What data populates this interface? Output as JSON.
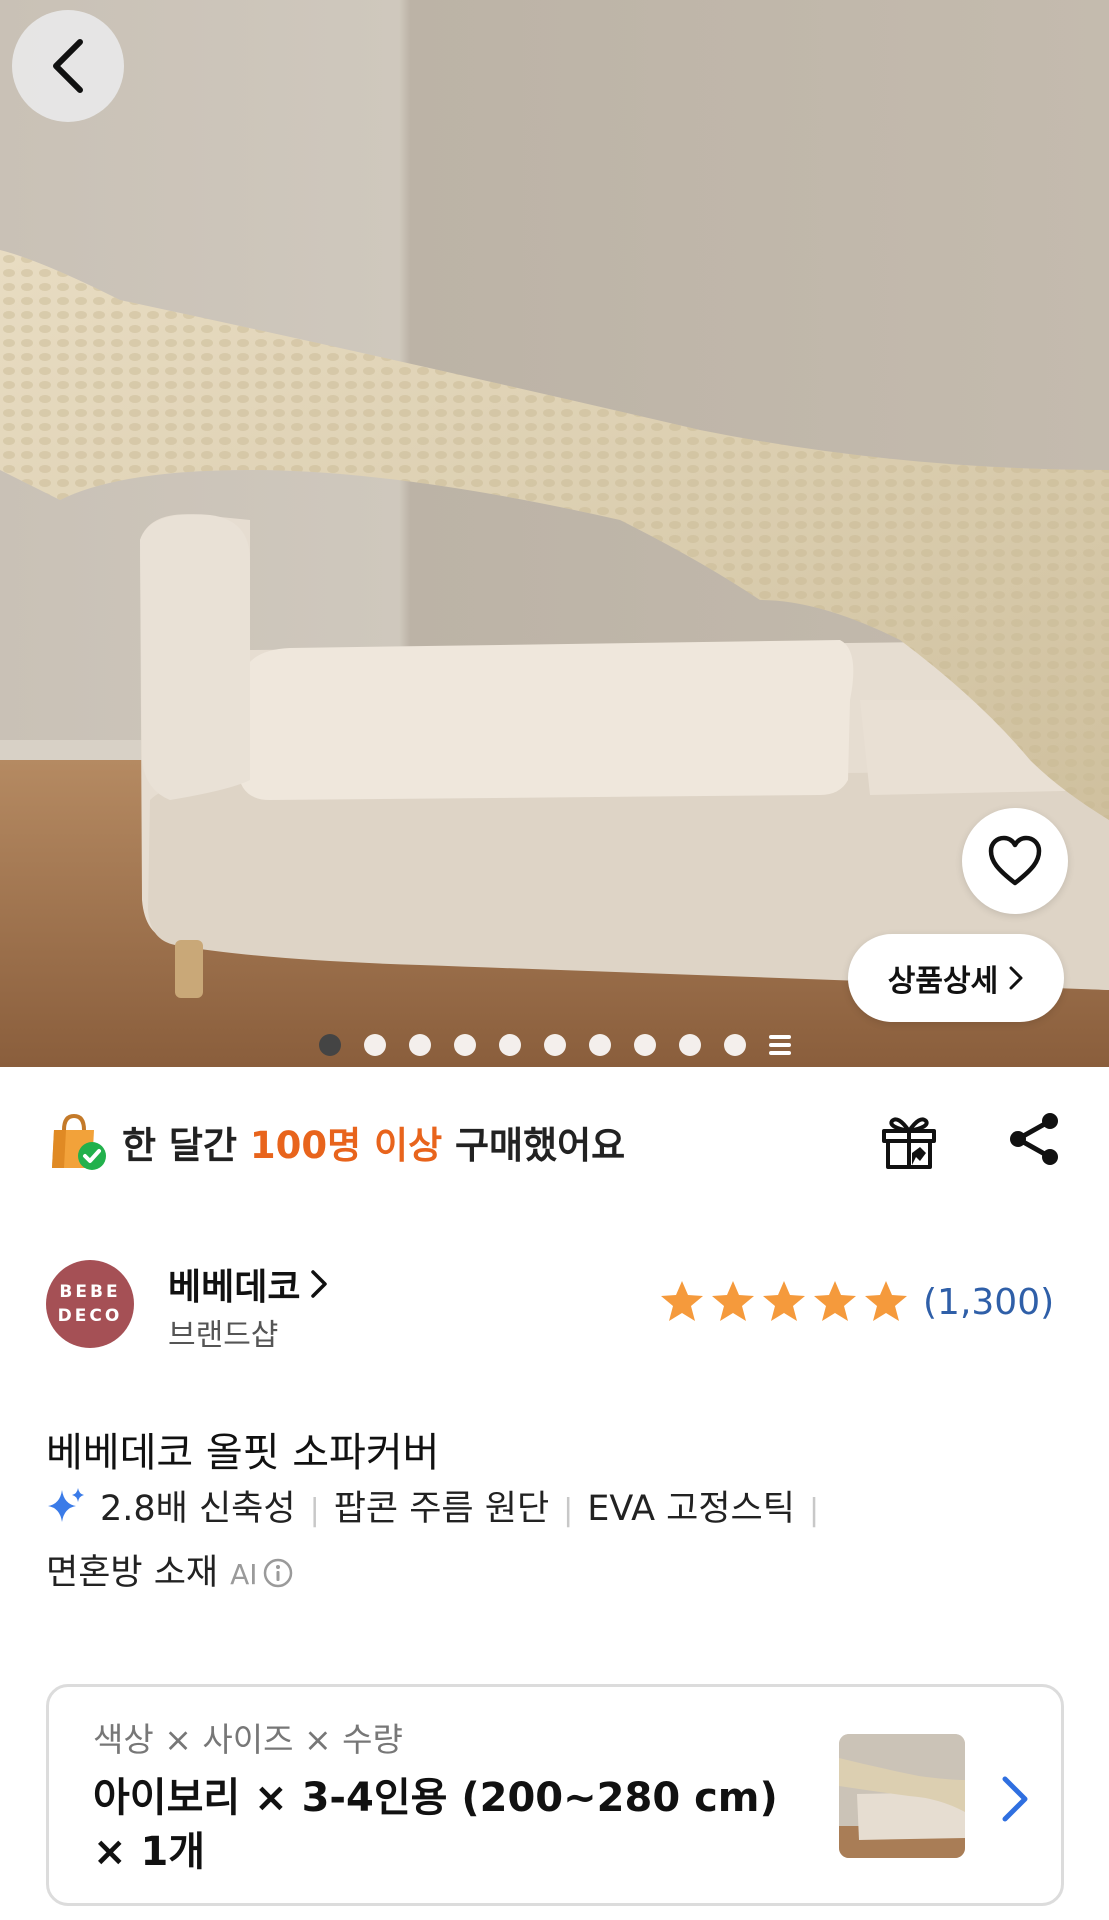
{
  "hero": {
    "image_description_icon": "sofa-cover-product-photo",
    "slide_count": 10,
    "active_slide": 1,
    "detail_button_label": "상품상세"
  },
  "purchase_info": {
    "prefix": "한 달간 ",
    "highlight": "100명 이상",
    "suffix": " 구매했어요",
    "highlight_color": "#e8641c"
  },
  "brand": {
    "logo_line1": "BEBE",
    "logo_line2": "DECO",
    "logo_color": "#a55055",
    "name": "베베데코",
    "type": "브랜드샵"
  },
  "rating": {
    "stars": 5,
    "count": "(1,300)",
    "star_color": "#f59a3c"
  },
  "product": {
    "title": "베베데코 올핏 소파커버",
    "features": [
      "2.8배 신축성",
      "팝콘 주름 원단",
      "EVA 고정스틱",
      "면혼방 소재"
    ],
    "ai_label": "AI"
  },
  "option": {
    "label_color": "색상",
    "label_size": "사이즈",
    "label_qty": "수량",
    "separator": "×",
    "value_line1": "아이보리 × 3-4인용 (200~280 cm)",
    "value_line2": "× 1개"
  }
}
